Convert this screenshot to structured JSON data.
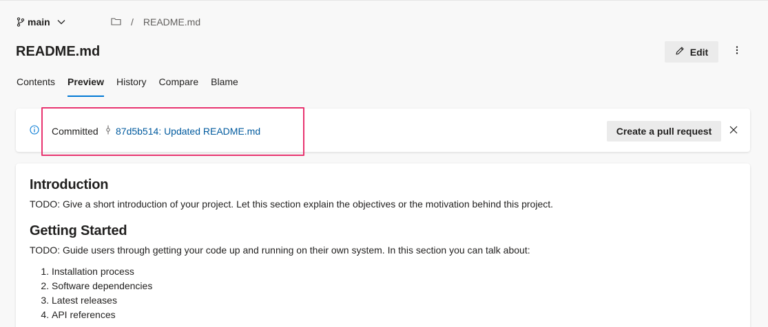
{
  "branch": {
    "name": "main"
  },
  "breadcrumb": {
    "separator": "/",
    "file": "README.md"
  },
  "title": "README.md",
  "toolbar": {
    "edit_label": "Edit"
  },
  "tabs": [
    {
      "label": "Contents",
      "active": false
    },
    {
      "label": "Preview",
      "active": true
    },
    {
      "label": "History",
      "active": false
    },
    {
      "label": "Compare",
      "active": false
    },
    {
      "label": "Blame",
      "active": false
    }
  ],
  "banner": {
    "status": "Committed",
    "commit_link": "87d5b514: Updated README.md",
    "pr_button": "Create a pull request"
  },
  "readme": {
    "intro_heading": "Introduction",
    "intro_text": "TODO: Give a short introduction of your project. Let this section explain the objectives or the motivation behind this project.",
    "gs_heading": "Getting Started",
    "gs_text": "TODO: Guide users through getting your code up and running on their own system. In this section you can talk about:",
    "items": [
      "Installation process",
      "Software dependencies",
      "Latest releases",
      "API references"
    ]
  },
  "colors": {
    "accent": "#0078d4",
    "link": "#005a9e",
    "highlight": "#e8336f"
  }
}
